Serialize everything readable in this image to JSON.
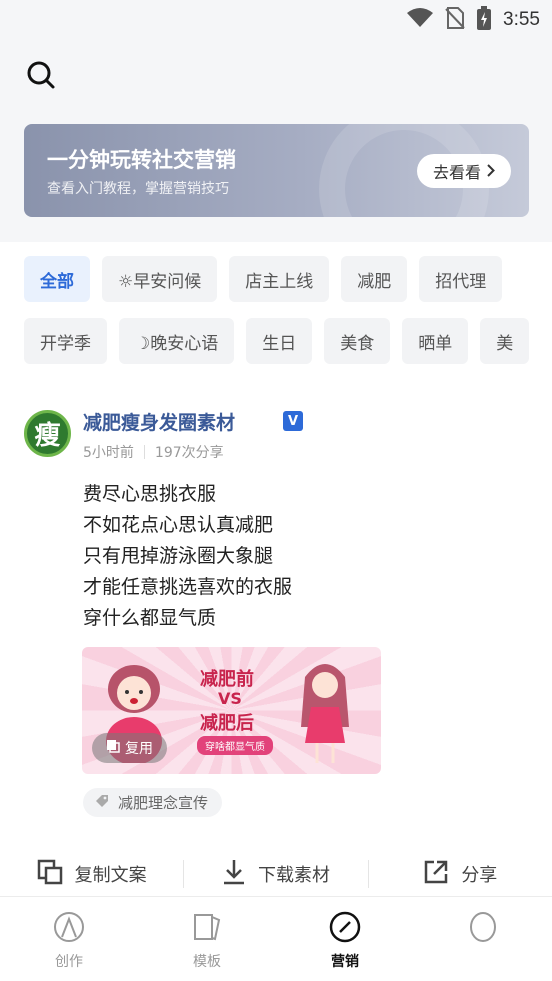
{
  "status_bar": {
    "time": "3:55"
  },
  "banner": {
    "title": "一分钟玩转社交营销",
    "subtitle": "查看入门教程，掌握营销技巧",
    "button_label": "去看看"
  },
  "categories_row1": [
    "全部",
    "☼早安问候",
    "店主上线",
    "减肥",
    "招代理"
  ],
  "categories_row2": [
    "开学季",
    "☽晚安心语",
    "生日",
    "美食",
    "晒单",
    "美"
  ],
  "post": {
    "avatar_char": "瘦",
    "title": "减肥瘦身发圈素材",
    "verified_badge": "V",
    "time": "5小时前",
    "shares": "197次分享",
    "lines": [
      "费尽心思挑衣服",
      "不如花点心思认真减肥",
      "只有甩掉游泳圈大象腿",
      "才能任意挑选喜欢的衣服",
      "穿什么都显气质"
    ],
    "image": {
      "text_before": "减肥前",
      "text_vs": "VS",
      "text_after": "减肥后",
      "badge": "穿啥都显气质"
    },
    "reuse_label": "复用",
    "tag": "减肥理念宣传"
  },
  "actions": {
    "copy": "复制文案",
    "download": "下载素材",
    "share": "分享"
  },
  "tabs": [
    {
      "label": "创作",
      "icon": "create-icon",
      "active": false
    },
    {
      "label": "模板",
      "icon": "template-icon",
      "active": false
    },
    {
      "label": "营销",
      "icon": "marketing-icon",
      "active": true
    },
    {
      "label": "",
      "icon": "profile-icon",
      "active": false
    }
  ],
  "colors": {
    "accent": "#2d6ad8",
    "banner": "#8a93ac",
    "brand_name": "#3b5a98"
  }
}
